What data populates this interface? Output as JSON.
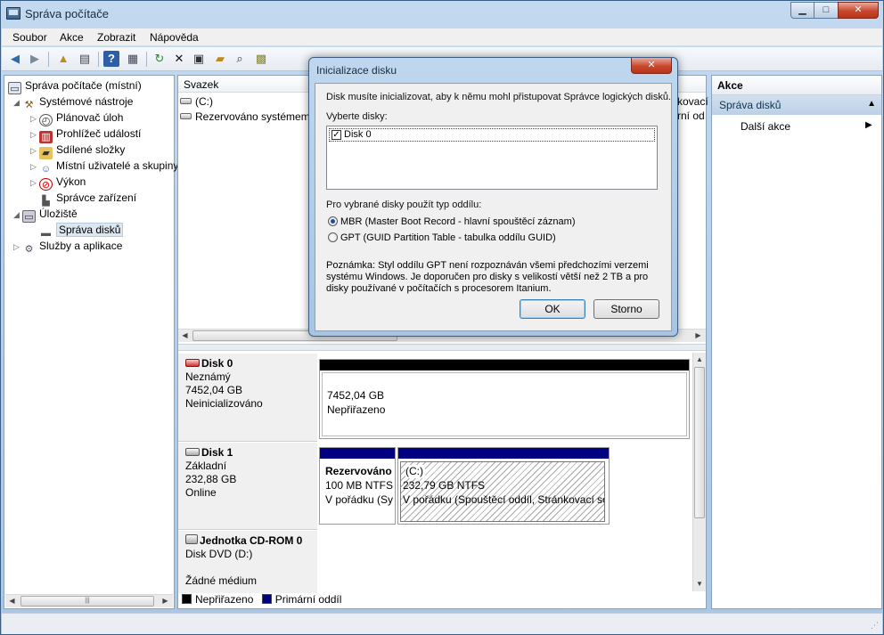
{
  "window": {
    "title": "Správa počítače",
    "min": "▁",
    "max": "□",
    "close": "✕"
  },
  "menu": [
    "Soubor",
    "Akce",
    "Zobrazit",
    "Nápověda"
  ],
  "tree": {
    "root": "Správa počítače (místní)",
    "system_tools": "Systémové nástroje",
    "task_scheduler": "Plánovač úloh",
    "event_viewer": "Prohlížeč událostí",
    "shared_folders": "Sdílené složky",
    "local_users": "Místní uživatelé a skupiny",
    "performance": "Výkon",
    "device_manager": "Správce zařízení",
    "storage": "Úložiště",
    "disk_management": "Správa disků",
    "services": "Služby a aplikace"
  },
  "volumes": {
    "col_volume": "Svazek",
    "rows": [
      "(C:)",
      "Rezervováno systémem"
    ],
    "partial_right_1": "kovací",
    "partial_right_2": "rní od"
  },
  "disks": [
    {
      "name": "Disk 0",
      "type": "Neznámý",
      "size": "7452,04 GB",
      "status": "Neinicializováno",
      "partitions": [
        {
          "size": "7452,04 GB",
          "state": "Nepřiřazeno"
        }
      ]
    },
    {
      "name": "Disk 1",
      "type": "Základní",
      "size": "232,88 GB",
      "status": "Online",
      "partitions": [
        {
          "name": "Rezervováno",
          "size": "100 MB NTFS",
          "state": "V pořádku (Sy"
        },
        {
          "name": "(C:)",
          "size": "232,79 GB NTFS",
          "state": "V pořádku (Spouštěcí oddíl, Stránkovací sc"
        }
      ]
    },
    {
      "name": "Jednotka CD-ROM 0",
      "type": "Disk DVD (D:)",
      "media": "Žádné médium"
    }
  ],
  "legend": {
    "unallocated": "Nepřiřazeno",
    "primary": "Primární oddíl"
  },
  "actions": {
    "header": "Akce",
    "section": "Správa disků",
    "more": "Další akce"
  },
  "dialog": {
    "title": "Inicializace disku",
    "intro": "Disk musíte inicializovat, aby k němu mohl přistupovat Správce logických disků.",
    "select_label": "Vyberte disky:",
    "disk_item": "Disk 0",
    "style_label": "Pro vybrané disky použít typ oddílu:",
    "mbr": "MBR (Master Boot Record - hlavní spouštěcí záznam)",
    "gpt": "GPT (GUID Partition Table - tabulka oddílu GUID)",
    "note_1": "Poznámka: Styl oddílu GPT není rozpoznáván všemi předchozími verzemi",
    "note_2": "systému Windows. Je doporučen pro disky s velikostí větší než 2 TB a pro",
    "note_3": "disky používané v počítačích s procesorem Itanium.",
    "ok": "OK",
    "cancel": "Storno"
  },
  "colors": {
    "unallocated": "#000000",
    "primary": "#000080",
    "accent": "#c9462c"
  }
}
